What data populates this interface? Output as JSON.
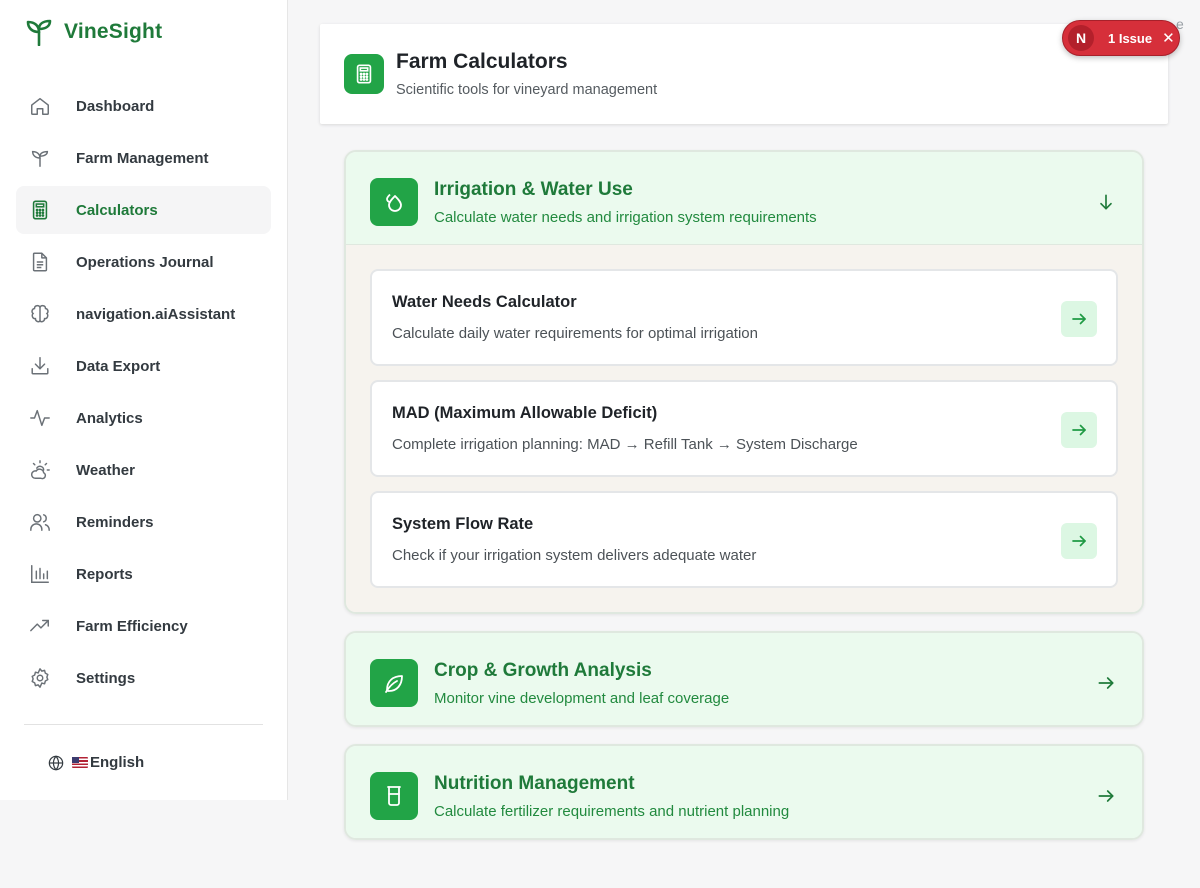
{
  "brand": {
    "name": "VineSight"
  },
  "sidebar": {
    "items": [
      {
        "label": "Dashboard",
        "icon": "home-icon"
      },
      {
        "label": "Farm Management",
        "icon": "sprout-icon"
      },
      {
        "label": "Calculators",
        "icon": "calculator-icon",
        "active": true
      },
      {
        "label": "Operations Journal",
        "icon": "document-icon"
      },
      {
        "label": "navigation.aiAssistant",
        "icon": "brain-icon"
      },
      {
        "label": "Data Export",
        "icon": "download-icon"
      },
      {
        "label": "Analytics",
        "icon": "activity-icon"
      },
      {
        "label": "Weather",
        "icon": "cloud-sun-icon"
      },
      {
        "label": "Reminders",
        "icon": "users-icon"
      },
      {
        "label": "Reports",
        "icon": "bar-chart-icon"
      },
      {
        "label": "Farm Efficiency",
        "icon": "trending-up-icon"
      },
      {
        "label": "Settings",
        "icon": "gear-icon"
      }
    ],
    "language": "English"
  },
  "header": {
    "title": "Farm Calculators",
    "subtitle": "Scientific tools for vineyard management"
  },
  "issue_badge": {
    "letter": "N",
    "label": "1 Issue",
    "edge_char": "e"
  },
  "sections": [
    {
      "title": "Irrigation & Water Use",
      "subtitle": "Calculate water needs and irrigation system requirements",
      "icon": "droplets-icon",
      "expanded": true,
      "calculators": [
        {
          "title": "Water Needs Calculator",
          "description": "Calculate daily water requirements for optimal irrigation"
        },
        {
          "title": "MAD (Maximum Allowable Deficit)",
          "description": "Complete irrigation planning: MAD → Refill Tank → System Discharge"
        },
        {
          "title": "System Flow Rate",
          "description": "Check if your irrigation system delivers adequate water"
        }
      ]
    },
    {
      "title": "Crop & Growth Analysis",
      "subtitle": "Monitor vine development and leaf coverage",
      "icon": "leaf-icon",
      "expanded": false
    },
    {
      "title": "Nutrition Management",
      "subtitle": "Calculate fertilizer requirements and nutrient planning",
      "icon": "beaker-icon",
      "expanded": false
    }
  ],
  "colors": {
    "brand_green": "#1f7a3a",
    "accent_green": "#22a447",
    "section_bg": "#ebfaee",
    "body_bg": "#f6f3ee",
    "issue_red": "#d62f3a"
  }
}
